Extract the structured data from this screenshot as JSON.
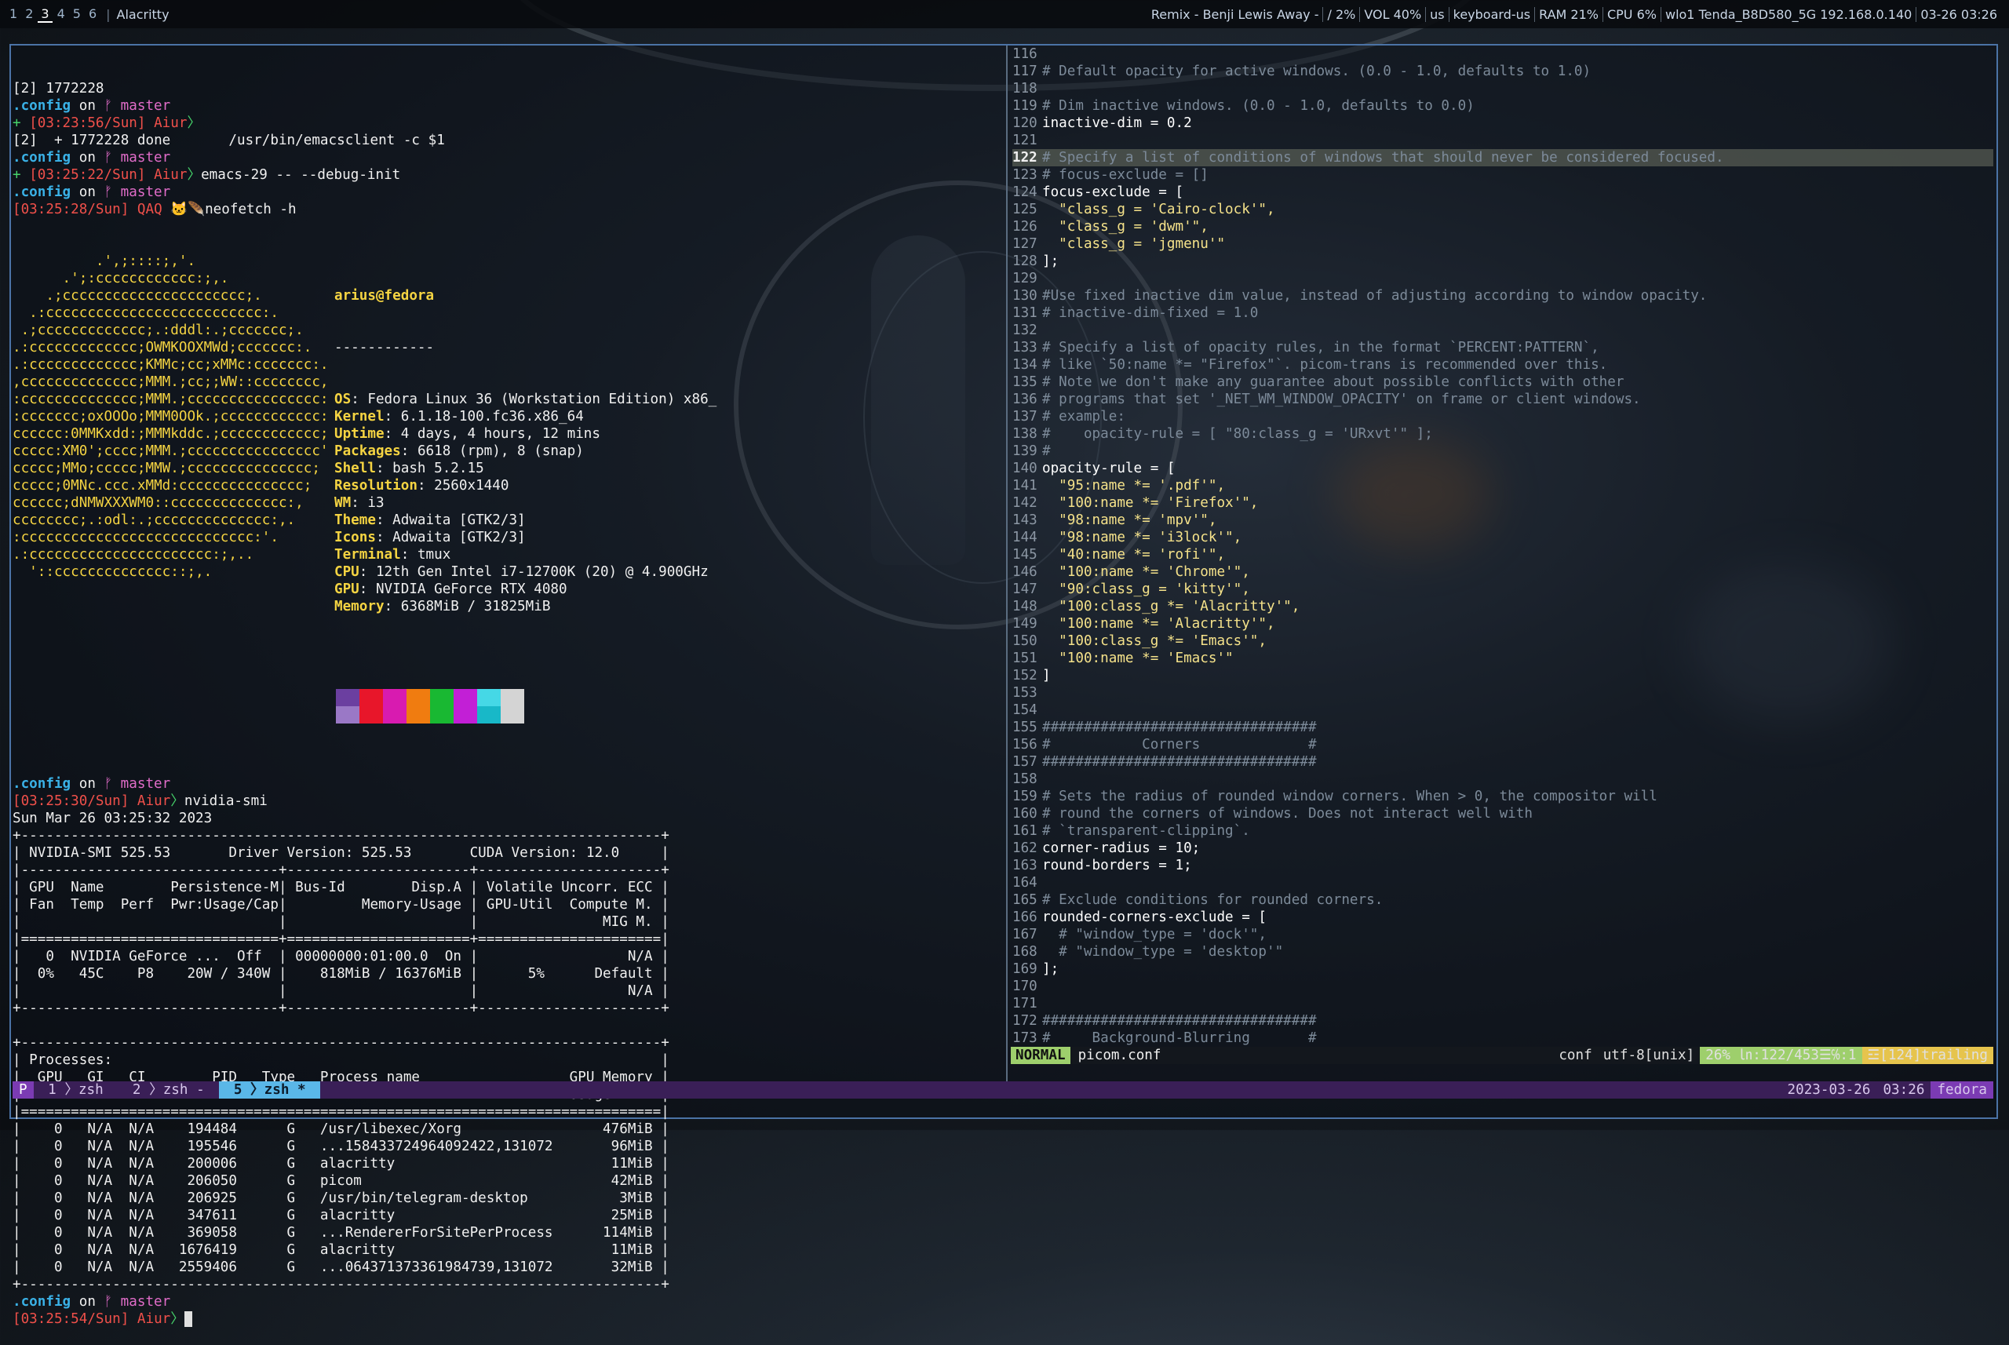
{
  "topbar": {
    "workspaces": [
      "1",
      "2",
      "3",
      "4",
      "5",
      "6"
    ],
    "active_workspace": "3",
    "window_title": "Alacritty",
    "status_items": [
      "Remix - Benji Lewis  Away -",
      "/ 2%",
      "VOL 40%",
      "us",
      "keyboard-us",
      "RAM 21%",
      "CPU  6%",
      "wlo1 Tenda_B8D580_5G 192.168.0.140",
      "03-26 03:26"
    ]
  },
  "left_pane": {
    "pre": [
      {
        "parts": [
          [
            "[2] 1772228",
            "c-white"
          ]
        ]
      },
      {
        "parts": [
          [
            ".config",
            "c-cyan"
          ],
          [
            " on ",
            "c-white"
          ],
          [
            "ᚠ master",
            "c-pink"
          ]
        ]
      },
      {
        "parts": [
          [
            "+ ",
            "c-green"
          ],
          [
            "[03:23:56/Sun] Aiur",
            "c-red"
          ],
          [
            "〉",
            "c-green"
          ]
        ]
      },
      {
        "parts": [
          [
            "[2]  + 1772228 done       /usr/bin/emacsclient -c $1",
            "c-white"
          ]
        ]
      },
      {
        "parts": [
          [
            ".config",
            "c-cyan"
          ],
          [
            " on ",
            "c-white"
          ],
          [
            "ᚠ master",
            "c-pink"
          ]
        ]
      },
      {
        "parts": [
          [
            "+ ",
            "c-green"
          ],
          [
            "[03:25:22/Sun] Aiur",
            "c-red"
          ],
          [
            "〉",
            "c-green"
          ],
          [
            "emacs-29 -- --debug-init",
            "c-white"
          ]
        ]
      },
      {
        "parts": [
          [
            ".config",
            "c-cyan"
          ],
          [
            " on ",
            "c-white"
          ],
          [
            "ᚠ master",
            "c-pink"
          ]
        ]
      },
      {
        "parts": [
          [
            "[03:25:28/Sun] QAQ 🐱🪶",
            "c-red"
          ],
          [
            "neofetch -h",
            "c-white"
          ]
        ]
      }
    ],
    "neofetch": {
      "logo": [
        "          .',;::::;,'.",
        "      .';:cccccccccccc:;,.",
        "    .;cccccccccccccccccccccc;.",
        "  .:cccccccccccccccccccccccccc:.",
        " .;ccccccccccccc;.:dddl:.;ccccccc;.",
        ".:ccccccccccccc;OWMKOOXMWd;ccccccc:.",
        ".:ccccccccccccc;KMMc;cc;xMMc:ccccccc:.",
        ",cccccccccccccc;MMM.;cc;;WW::cccccccc,",
        ":cccccccccccccc;MMM.;cccccccccccccccc:",
        ":ccccccc;oxOOOo;MMM0OOk.;cccccccccccc:",
        "cccccc:0MMKxdd:;MMMkddc.;cccccccccccc;",
        "ccccc:XM0';cccc;MMM.;cccccccccccccccc'",
        "ccccc;MMo;ccccc;MMW.;ccccccccccccccc;",
        "ccccc;0MNc.ccc.xMMd:ccccccccccccccc;",
        "cccccc;dNMWXXXWM0::cccccccccccccc:,",
        "cccccccc;.:odl:.;cccccccccccccc:,.",
        ":cccccccccccccccccccccccccccc:'.",
        ".:cccccccccccccccccccccc:;,..",
        "  '::cccccccccccccc::;,."
      ],
      "user_host": "arius@fedora",
      "underline": "------------",
      "info": [
        {
          "k": "OS",
          "v": "Fedora Linux 36 (Workstation Edition) x86_"
        },
        {
          "k": "Kernel",
          "v": "6.1.18-100.fc36.x86_64"
        },
        {
          "k": "Uptime",
          "v": "4 days, 4 hours, 12 mins"
        },
        {
          "k": "Packages",
          "v": "6618 (rpm), 8 (snap)"
        },
        {
          "k": "Shell",
          "v": "bash 5.2.15"
        },
        {
          "k": "Resolution",
          "v": "2560x1440"
        },
        {
          "k": "WM",
          "v": "i3"
        },
        {
          "k": "Theme",
          "v": "Adwaita [GTK2/3]"
        },
        {
          "k": "Icons",
          "v": "Adwaita [GTK2/3]"
        },
        {
          "k": "Terminal",
          "v": "tmux"
        },
        {
          "k": "CPU",
          "v": "12th Gen Intel i7-12700K (20) @ 4.900GHz"
        },
        {
          "k": "GPU",
          "v": "NVIDIA GeForce RTX 4080"
        },
        {
          "k": "Memory",
          "v": "6368MiB / 31825MiB"
        }
      ],
      "swatch_top": [
        "#6b3fa0",
        "#e8162a",
        "#d81bb0",
        "#f07c10",
        "#19b832",
        "#c21fd6",
        "#45d8e6",
        "#d4d4d4"
      ],
      "swatch_bottom": [
        "#9a78c6",
        "#e8162a",
        "#d81bb0",
        "#f07c10",
        "#19b832",
        "#c21fd6",
        "#18b8c8",
        "#d4d4d4"
      ]
    },
    "post": [
      {
        "parts": [
          [
            "",
            "c-white"
          ]
        ]
      },
      {
        "parts": [
          [
            ".config",
            "c-cyan"
          ],
          [
            " on ",
            "c-white"
          ],
          [
            "ᚠ master",
            "c-pink"
          ]
        ]
      },
      {
        "parts": [
          [
            "[03:25:30/Sun] Aiur",
            "c-red"
          ],
          [
            "〉",
            "c-green"
          ],
          [
            "nvidia-smi",
            "c-white"
          ]
        ]
      },
      {
        "parts": [
          [
            "Sun Mar 26 03:25:32 2023",
            "c-white"
          ]
        ]
      },
      {
        "parts": [
          [
            "+-----------------------------------------------------------------------------+",
            "c-white"
          ]
        ]
      },
      {
        "parts": [
          [
            "| NVIDIA-SMI 525.53       Driver Version: 525.53       CUDA Version: 12.0     |",
            "c-white"
          ]
        ]
      },
      {
        "parts": [
          [
            "|-------------------------------+----------------------+----------------------+",
            "c-white"
          ]
        ]
      },
      {
        "parts": [
          [
            "| GPU  Name        Persistence-M| Bus-Id        Disp.A | Volatile Uncorr. ECC |",
            "c-white"
          ]
        ]
      },
      {
        "parts": [
          [
            "| Fan  Temp  Perf  Pwr:Usage/Cap|         Memory-Usage | GPU-Util  Compute M. |",
            "c-white"
          ]
        ]
      },
      {
        "parts": [
          [
            "|                               |                      |               MIG M. |",
            "c-white"
          ]
        ]
      },
      {
        "parts": [
          [
            "|===============================+======================+======================|",
            "c-white"
          ]
        ]
      },
      {
        "parts": [
          [
            "|   0  NVIDIA GeForce ...  Off  | 00000000:01:00.0  On |                  N/A |",
            "c-white"
          ]
        ]
      },
      {
        "parts": [
          [
            "|  0%   45C    P8    20W / 340W |    818MiB / 16376MiB |      5%      Default |",
            "c-white"
          ]
        ]
      },
      {
        "parts": [
          [
            "|                               |                      |                  N/A |",
            "c-white"
          ]
        ]
      },
      {
        "parts": [
          [
            "+-------------------------------+----------------------+----------------------+",
            "c-white"
          ]
        ]
      },
      {
        "parts": [
          [
            "",
            "c-white"
          ]
        ]
      },
      {
        "parts": [
          [
            "+-----------------------------------------------------------------------------+",
            "c-white"
          ]
        ]
      },
      {
        "parts": [
          [
            "| Processes:                                                                  |",
            "c-white"
          ]
        ]
      },
      {
        "parts": [
          [
            "|  GPU   GI   CI        PID   Type   Process name                  GPU Memory |",
            "c-white"
          ]
        ]
      },
      {
        "parts": [
          [
            "|        ID   ID                                                   Usage      |",
            "c-white"
          ]
        ]
      },
      {
        "parts": [
          [
            "|=============================================================================|",
            "c-white"
          ]
        ]
      },
      {
        "parts": [
          [
            "|    0   N/A  N/A    194484      G   /usr/libexec/Xorg                 476MiB |",
            "c-white"
          ]
        ]
      },
      {
        "parts": [
          [
            "|    0   N/A  N/A    195546      G   ...158433724964092422,131072       96MiB |",
            "c-white"
          ]
        ]
      },
      {
        "parts": [
          [
            "|    0   N/A  N/A    200006      G   alacritty                          11MiB |",
            "c-white"
          ]
        ]
      },
      {
        "parts": [
          [
            "|    0   N/A  N/A    206050      G   picom                              42MiB |",
            "c-white"
          ]
        ]
      },
      {
        "parts": [
          [
            "|    0   N/A  N/A    206925      G   /usr/bin/telegram-desktop           3MiB |",
            "c-white"
          ]
        ]
      },
      {
        "parts": [
          [
            "|    0   N/A  N/A    347611      G   alacritty                          25MiB |",
            "c-white"
          ]
        ]
      },
      {
        "parts": [
          [
            "|    0   N/A  N/A    369058      G   ...RendererForSitePerProcess      114MiB |",
            "c-white"
          ]
        ]
      },
      {
        "parts": [
          [
            "|    0   N/A  N/A   1676419      G   alacritty                          11MiB |",
            "c-white"
          ]
        ]
      },
      {
        "parts": [
          [
            "|    0   N/A  N/A   2559406      G   ...064371373361984739,131072       32MiB |",
            "c-white"
          ]
        ]
      },
      {
        "parts": [
          [
            "+-----------------------------------------------------------------------------+",
            "c-white"
          ]
        ]
      },
      {
        "parts": [
          [
            ".config",
            "c-cyan"
          ],
          [
            " on ",
            "c-white"
          ],
          [
            "ᚠ master",
            "c-pink"
          ]
        ]
      },
      {
        "parts": [
          [
            "[03:25:54/Sun] Aiur",
            "c-red"
          ],
          [
            "〉",
            "c-green"
          ],
          [
            " ",
            "cursor"
          ]
        ]
      }
    ]
  },
  "right_pane": {
    "current_line": "122",
    "lines": [
      {
        "n": "116",
        "t": "",
        "c": "code"
      },
      {
        "n": "117",
        "t": "# Default opacity for active windows. (0.0 - 1.0, defaults to 1.0)",
        "c": "cmt"
      },
      {
        "n": "118",
        "t": "",
        "c": "code"
      },
      {
        "n": "119",
        "t": "# Dim inactive windows. (0.0 - 1.0, defaults to 0.0)",
        "c": "cmt"
      },
      {
        "n": "120",
        "t": "inactive-dim = 0.2",
        "c": "code"
      },
      {
        "n": "121",
        "t": "",
        "c": "code"
      },
      {
        "n": "122",
        "t": "# Specify a list of conditions of windows that should never be considered focused.",
        "c": "cmt hl"
      },
      {
        "n": "123",
        "t": "# focus-exclude = []",
        "c": "cmt"
      },
      {
        "n": "124",
        "t": "focus-exclude = [",
        "c": "code"
      },
      {
        "n": "125",
        "t": "  \"class_g = 'Cairo-clock'\",",
        "c": "str"
      },
      {
        "n": "126",
        "t": "  \"class_g = 'dwm'\",",
        "c": "str"
      },
      {
        "n": "127",
        "t": "  \"class_g = 'jgmenu'\"",
        "c": "str"
      },
      {
        "n": "128",
        "t": "];",
        "c": "code"
      },
      {
        "n": "129",
        "t": "",
        "c": "code"
      },
      {
        "n": "130",
        "t": "#Use fixed inactive dim value, instead of adjusting according to window opacity.",
        "c": "cmt"
      },
      {
        "n": "131",
        "t": "# inactive-dim-fixed = 1.0",
        "c": "cmt"
      },
      {
        "n": "132",
        "t": "",
        "c": "code"
      },
      {
        "n": "133",
        "t": "# Specify a list of opacity rules, in the format `PERCENT:PATTERN`,",
        "c": "cmt"
      },
      {
        "n": "134",
        "t": "# like `50:name *= \"Firefox\"`. picom-trans is recommended over this.",
        "c": "cmt"
      },
      {
        "n": "135",
        "t": "# Note we don't make any guarantee about possible conflicts with other",
        "c": "cmt"
      },
      {
        "n": "136",
        "t": "# programs that set '_NET_WM_WINDOW_OPACITY' on frame or client windows.",
        "c": "cmt"
      },
      {
        "n": "137",
        "t": "# example:",
        "c": "cmt"
      },
      {
        "n": "138",
        "t": "#    opacity-rule = [ \"80:class_g = 'URxvt'\" ];",
        "c": "cmt"
      },
      {
        "n": "139",
        "t": "#",
        "c": "cmt"
      },
      {
        "n": "140",
        "t": "opacity-rule = [",
        "c": "code"
      },
      {
        "n": "141",
        "t": "  \"95:name *= '.pdf'\",",
        "c": "str"
      },
      {
        "n": "142",
        "t": "  \"100:name *= 'Firefox'\",",
        "c": "str"
      },
      {
        "n": "143",
        "t": "  \"98:name *= 'mpv'\",",
        "c": "str"
      },
      {
        "n": "144",
        "t": "  \"98:name *= 'i3lock'\",",
        "c": "str"
      },
      {
        "n": "145",
        "t": "  \"40:name *= 'rofi'\",",
        "c": "str"
      },
      {
        "n": "146",
        "t": "  \"100:name *= 'Chrome'\",",
        "c": "str"
      },
      {
        "n": "147",
        "t": "  \"90:class_g = 'kitty'\",",
        "c": "str"
      },
      {
        "n": "148",
        "t": "  \"100:class_g *= 'Alacritty'\",",
        "c": "str"
      },
      {
        "n": "149",
        "t": "  \"100:name *= 'Alacritty'\",",
        "c": "str"
      },
      {
        "n": "150",
        "t": "  \"100:class_g *= 'Emacs'\",",
        "c": "str"
      },
      {
        "n": "151",
        "t": "  \"100:name *= 'Emacs'\"",
        "c": "str"
      },
      {
        "n": "152",
        "t": "]",
        "c": "code"
      },
      {
        "n": "153",
        "t": "",
        "c": "code"
      },
      {
        "n": "154",
        "t": "",
        "c": "code"
      },
      {
        "n": "155",
        "t": "#################################",
        "c": "cmt"
      },
      {
        "n": "156",
        "t": "#           Corners             #",
        "c": "cmt"
      },
      {
        "n": "157",
        "t": "#################################",
        "c": "cmt"
      },
      {
        "n": "158",
        "t": "",
        "c": "code"
      },
      {
        "n": "159",
        "t": "# Sets the radius of rounded window corners. When > 0, the compositor will",
        "c": "cmt"
      },
      {
        "n": "160",
        "t": "# round the corners of windows. Does not interact well with",
        "c": "cmt"
      },
      {
        "n": "161",
        "t": "# `transparent-clipping`.",
        "c": "cmt"
      },
      {
        "n": "162",
        "t": "corner-radius = 10;",
        "c": "code"
      },
      {
        "n": "163",
        "t": "round-borders = 1;",
        "c": "code"
      },
      {
        "n": "164",
        "t": "",
        "c": "code"
      },
      {
        "n": "165",
        "t": "# Exclude conditions for rounded corners.",
        "c": "cmt"
      },
      {
        "n": "166",
        "t": "rounded-corners-exclude = [",
        "c": "code"
      },
      {
        "n": "167",
        "t": "  # \"window_type = 'dock'\",",
        "c": "cmt"
      },
      {
        "n": "168",
        "t": "  # \"window_type = 'desktop'\"",
        "c": "cmt"
      },
      {
        "n": "169",
        "t": "];",
        "c": "code"
      },
      {
        "n": "170",
        "t": "",
        "c": "code"
      },
      {
        "n": "171",
        "t": "",
        "c": "code"
      },
      {
        "n": "172",
        "t": "#################################",
        "c": "cmt"
      },
      {
        "n": "173",
        "t": "#     Background-Blurring       #",
        "c": "cmt"
      }
    ]
  },
  "vim_status": {
    "mode": "NORMAL",
    "filename": "picom.conf",
    "filetype": "conf",
    "encoding": "utf-8[unix]",
    "position": "26% ㏑:122/453☰℅:1",
    "warning": "☲[124]trailing"
  },
  "tmux": {
    "session": "P",
    "windows": [
      {
        "label": " 1 〉zsh ",
        "active": false
      },
      {
        "label": " 2 〉zsh - ",
        "active": false
      },
      {
        "label": " 5 〉zsh * ",
        "active": true
      }
    ],
    "date": "2023-03-26",
    "time": "03:26",
    "host": "fedora"
  },
  "colors": {
    "accent_blue": "#4b73a6",
    "tmux_purple": "#7b3bb3",
    "vim_green": "#9ecf6c"
  }
}
